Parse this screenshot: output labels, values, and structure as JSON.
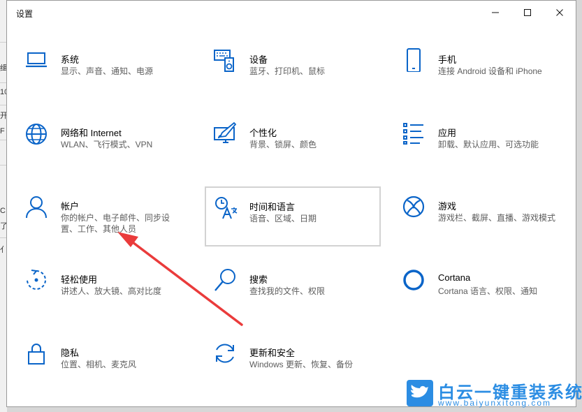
{
  "window": {
    "title": "设置"
  },
  "controls": {
    "minimize_icon": "minimize-icon",
    "maximize_icon": "maximize-icon",
    "close_icon": "close-icon"
  },
  "background": {
    "fragments": [
      "缉",
      "10",
      "开",
      "F",
      "C",
      "了",
      "亻"
    ]
  },
  "tiles": [
    {
      "id": "system",
      "name": "系统",
      "desc1": "显示、声音、通知、电源",
      "desc2": "",
      "icon": "laptop-icon"
    },
    {
      "id": "devices",
      "name": "设备",
      "desc1": "蓝牙、打印机、鼠标",
      "desc2": "",
      "icon": "keyboard-speaker-icon"
    },
    {
      "id": "phone",
      "name": "手机",
      "desc1": "连接 Android 设备和 iPhone",
      "desc2": "",
      "icon": "phone-icon"
    },
    {
      "id": "network",
      "name": "网络和 Internet",
      "desc1": "WLAN、飞行模式、VPN",
      "desc2": "",
      "icon": "globe-icon"
    },
    {
      "id": "personal",
      "name": "个性化",
      "desc1": "背景、锁屏、颜色",
      "desc2": "",
      "icon": "paint-monitor-icon"
    },
    {
      "id": "apps",
      "name": "应用",
      "desc1": "卸载、默认应用、可选功能",
      "desc2": "",
      "icon": "app-list-icon"
    },
    {
      "id": "accounts",
      "name": "帐户",
      "desc1": "你的帐户、电子邮件、同步设",
      "desc2": "置、工作、其他人员",
      "icon": "person-icon"
    },
    {
      "id": "time",
      "name": "时间和语言",
      "desc1": "语音、区域、日期",
      "desc2": "",
      "icon": "time-language-icon"
    },
    {
      "id": "gaming",
      "name": "游戏",
      "desc1": "游戏栏、截屏、直播、游戏模式",
      "desc2": "",
      "icon": "xbox-icon"
    },
    {
      "id": "ease",
      "name": "轻松使用",
      "desc1": "讲述人、放大镜、高对比度",
      "desc2": "",
      "icon": "ease-of-access-icon"
    },
    {
      "id": "search",
      "name": "搜索",
      "desc1": "查找我的文件、权限",
      "desc2": "",
      "icon": "search-icon"
    },
    {
      "id": "cortana",
      "name": "Cortana",
      "desc1": "Cortana 语言、权限、通知",
      "desc2": "",
      "icon": "cortana-circle-icon"
    },
    {
      "id": "privacy",
      "name": "隐私",
      "desc1": "位置、相机、麦克风",
      "desc2": "",
      "icon": "lock-icon"
    },
    {
      "id": "update",
      "name": "更新和安全",
      "desc1": "Windows 更新、恢复、备份",
      "desc2": "",
      "icon": "sync-icon"
    }
  ],
  "watermark": {
    "text": "白云一键重装系统",
    "url": "www.baiyunxitong.com",
    "icon": "bird-icon"
  },
  "colors": {
    "accent": "#0a64c8",
    "arrow": "#ea3b3b",
    "watermark": "#2b8de3"
  }
}
